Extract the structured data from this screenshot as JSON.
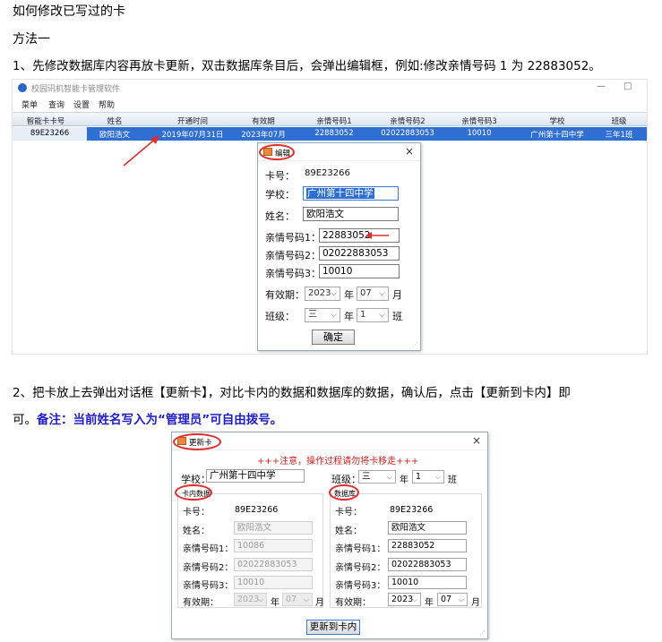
{
  "doc": {
    "title": "如何修改已写过的卡",
    "method": "方法一",
    "step1": "1、先修改数据库内容再放卡更新，双击数据库条目后，会弹出编辑框，例如:修改亲情号码 1 为 22883052。",
    "step2_line1": "2、把卡放上去弹出对话框【更新卡】，对比卡内的数据和数据库的数据，确认后，点击【更新到卡内】即",
    "step2_line2_prefix": "可。",
    "step2_note": "备注：当前姓名写入为“管理员”可自由拨号。"
  },
  "app": {
    "title": "校园讯机智能卡管理软件",
    "minimize": "—",
    "maximize": "□",
    "menu": [
      "菜单",
      "查询",
      "设置",
      "帮助"
    ],
    "columns": [
      "智能卡卡号",
      "姓名",
      "开通时间",
      "有效期",
      "亲情号码1",
      "亲情号码2",
      "亲情号码3",
      "学校",
      "班级"
    ],
    "row": [
      "89E23266",
      "欧阳浩文",
      "2019年07月31日",
      "2023年07月",
      "22883052",
      "02022883053",
      "10010",
      "广州第十四中学",
      "三年1班"
    ]
  },
  "edit_dialog": {
    "title": "编辑",
    "close": "×",
    "card_label": "卡号：",
    "card_value": "89E23266",
    "school_label": "学校：",
    "school_value": "广州第十四中学",
    "name_label": "姓名：",
    "name_value": "欧阳浩文",
    "phone1_label": "亲情号码1：",
    "phone1_value": "22883052",
    "phone2_label": "亲情号码2：",
    "phone2_value": "02022883053",
    "phone3_label": "亲情号码3：",
    "phone3_value": "10010",
    "valid_label": "有效期：",
    "valid_year": "2023",
    "year_unit": "年",
    "valid_month": "07",
    "month_unit": "月",
    "class_label": "班级：",
    "class_grade": "三",
    "class_year_unit": "年",
    "class_no": "1",
    "class_unit": "班",
    "confirm": "确定"
  },
  "update_dialog": {
    "title": "更新卡",
    "close": "×",
    "warning": "+++注意，操作过程请勿将卡移走+++",
    "school_label": "学校：",
    "school_value": "广州第十四中学",
    "class_label": "班级：",
    "class_grade": "三",
    "class_year_unit": "年",
    "class_no": "1",
    "class_unit": "班",
    "card_group": "卡内数据",
    "db_group": "数据库",
    "card": {
      "card_label": "卡号：",
      "card_value": "89E23266",
      "name_label": "姓名：",
      "name_value": "欧阳浩文",
      "p1_label": "亲情号码1：",
      "p1_value": "10086",
      "p2_label": "亲情号码2：",
      "p2_value": "02022883053",
      "p3_label": "亲情号码3：",
      "p3_value": "10010",
      "valid_label": "有效期：",
      "year": "2023",
      "year_unit": "年",
      "month": "07",
      "month_unit": "月"
    },
    "db": {
      "card_label": "卡号：",
      "card_value": "89E23266",
      "name_label": "姓名：",
      "name_value": "欧阳浩文",
      "p1_label": "亲情号码1：",
      "p1_value": "22883052",
      "p2_label": "亲情号码2：",
      "p2_value": "02022883053",
      "p3_label": "亲情号码3：",
      "p3_value": "10010",
      "valid_label": "有效期：",
      "year": "2023",
      "year_unit": "年",
      "month": "07",
      "month_unit": "月"
    },
    "update_button": "更新到卡内"
  },
  "colors": {
    "selection": "#2f6ed3",
    "annotation": "#e32b2b",
    "note": "#1d1dc8"
  }
}
